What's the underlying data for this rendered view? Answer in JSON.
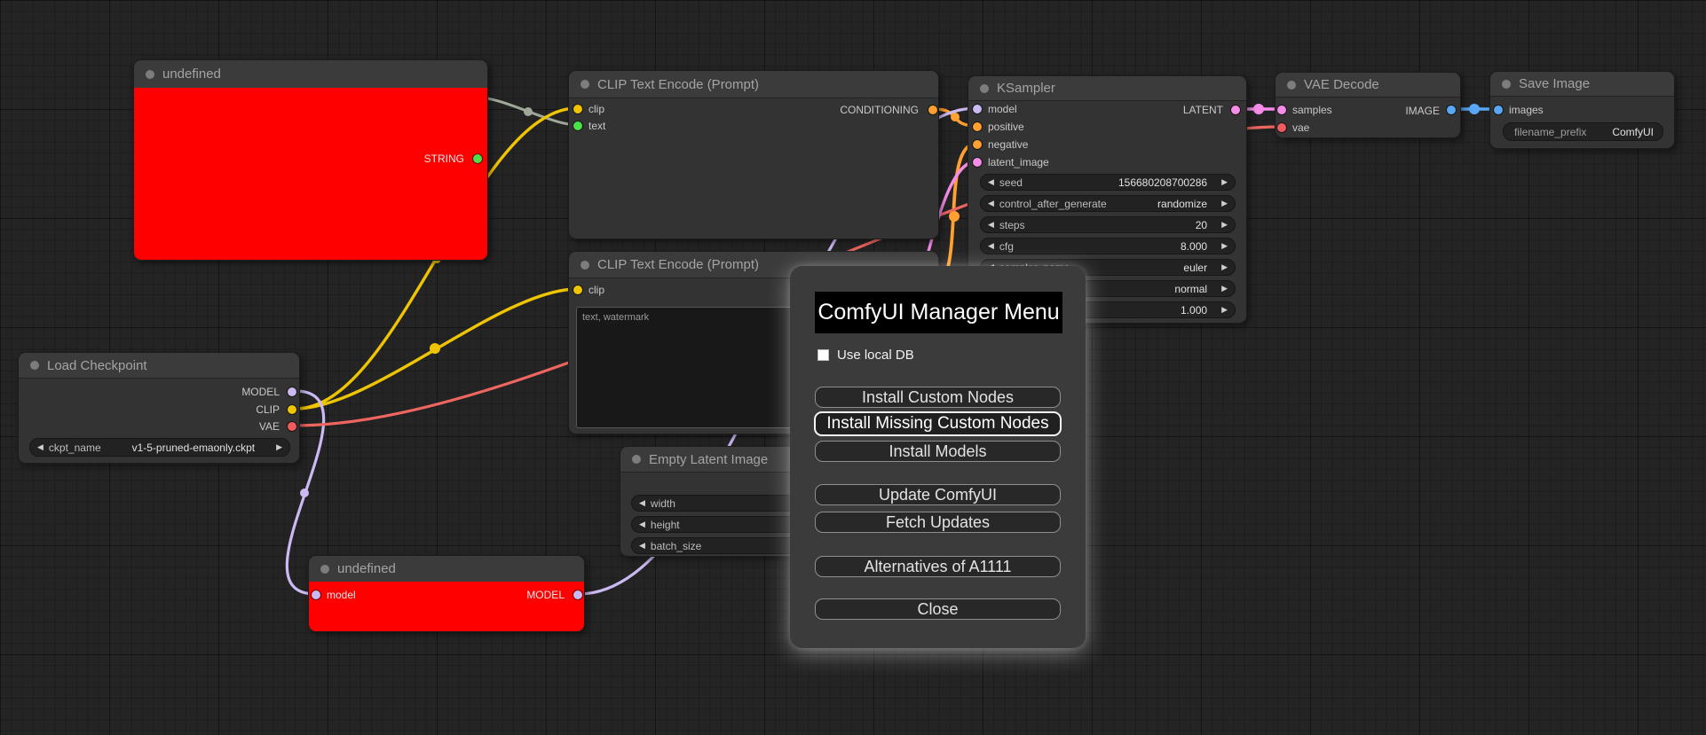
{
  "canvas": {
    "background": "#242424"
  },
  "colors": {
    "model": "#cbb9f2",
    "clip": "#efc400",
    "vae": "#ef6660",
    "conditioning": "#ffa030",
    "latent": "#f78ce8",
    "image": "#58a8f5",
    "string_dot": "#4ae24a",
    "string_wire": "#9fa89b",
    "error_node_body": "#ff0000"
  },
  "nodes": {
    "undefined_top": {
      "title": "undefined",
      "outputs": {
        "string": "STRING"
      }
    },
    "clip_text_encode_1": {
      "title": "CLIP Text Encode (Prompt)",
      "inputs": {
        "clip": "clip",
        "text": "text"
      },
      "outputs": {
        "conditioning": "CONDITIONING"
      }
    },
    "clip_text_encode_2": {
      "title": "CLIP Text Encode (Prompt)",
      "inputs": {
        "clip": "clip"
      },
      "text_value": "text, watermark"
    },
    "load_checkpoint": {
      "title": "Load Checkpoint",
      "outputs": {
        "model": "MODEL",
        "clip": "CLIP",
        "vae": "VAE"
      },
      "widgets": [
        {
          "label": "ckpt_name",
          "value": "v1-5-pruned-emaonly.ckpt"
        }
      ]
    },
    "ksampler": {
      "title": "KSampler",
      "inputs": {
        "model": "model",
        "positive": "positive",
        "negative": "negative",
        "latent_image": "latent_image"
      },
      "outputs": {
        "latent": "LATENT"
      },
      "widgets": [
        {
          "label": "seed",
          "value": "156680208700286"
        },
        {
          "label": "control_after_generate",
          "value": "randomize"
        },
        {
          "label": "steps",
          "value": "20"
        },
        {
          "label": "cfg",
          "value": "8.000"
        },
        {
          "label": "sampler_name",
          "value": "euler"
        },
        {
          "label": "",
          "value": "normal"
        },
        {
          "label": "",
          "value": "1.000"
        }
      ]
    },
    "vae_decode": {
      "title": "VAE Decode",
      "inputs": {
        "samples": "samples",
        "vae": "vae"
      },
      "outputs": {
        "image": "IMAGE"
      }
    },
    "save_image": {
      "title": "Save Image",
      "inputs": {
        "images": "images"
      },
      "widgets": [
        {
          "label": "filename_prefix",
          "value": "ComfyUI"
        }
      ]
    },
    "empty_latent_image": {
      "title": "Empty Latent Image",
      "widgets": [
        {
          "label": "width"
        },
        {
          "label": "height"
        },
        {
          "label": "batch_size"
        }
      ]
    },
    "undefined_bottom": {
      "title": "undefined",
      "inputs": {
        "model": "model"
      },
      "outputs": {
        "model": "MODEL"
      }
    }
  },
  "dialog": {
    "title": "ComfyUI Manager Menu",
    "checkbox": {
      "label": "Use local DB",
      "checked": false
    },
    "buttons": [
      "Install Custom Nodes",
      "Install Missing Custom Nodes",
      "Install Models",
      "Update ComfyUI",
      "Fetch Updates",
      "Alternatives of A1111",
      "Close"
    ],
    "highlighted_button": "Install Missing Custom Nodes"
  }
}
